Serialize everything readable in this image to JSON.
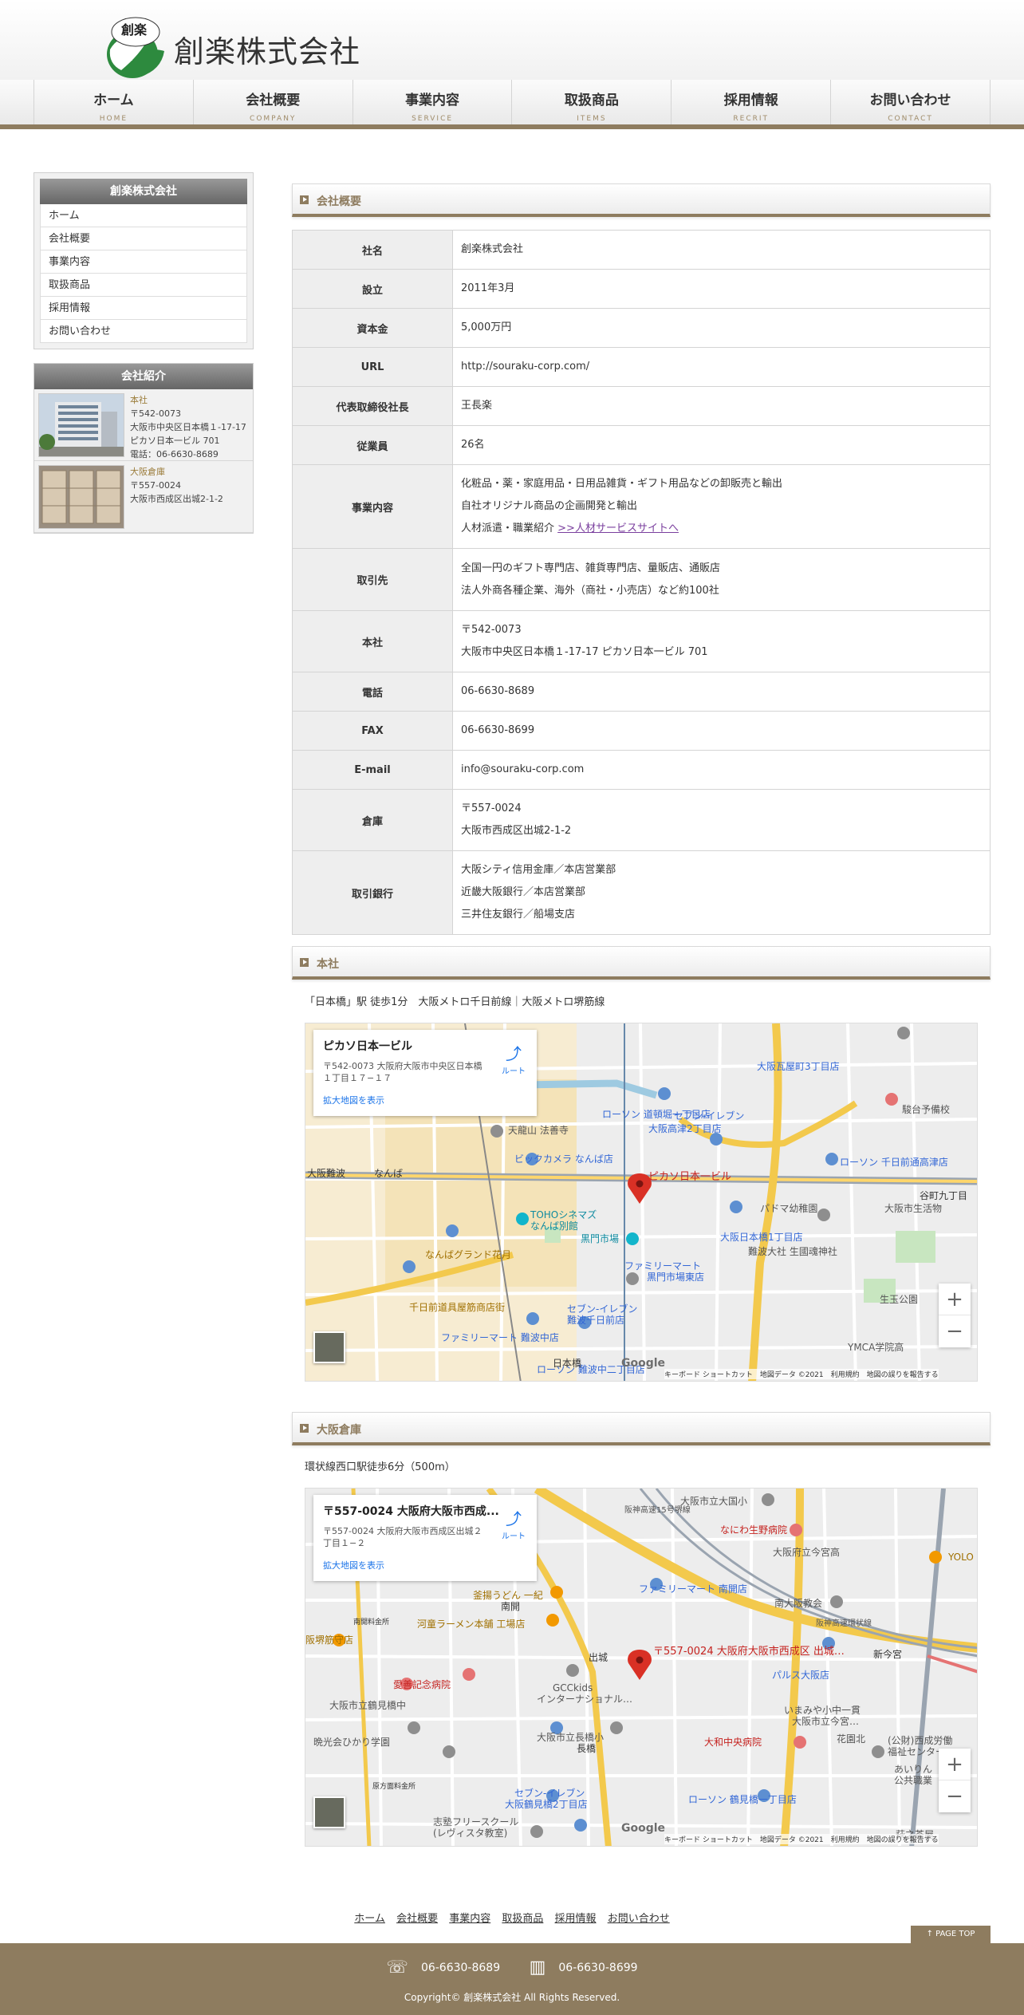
{
  "header": {
    "logo_top": "創楽",
    "logo_mark": "SR",
    "company_name": "創楽株式会社"
  },
  "nav": [
    {
      "jp": "ホーム",
      "en": "HOME"
    },
    {
      "jp": "会社概要",
      "en": "COMPANY"
    },
    {
      "jp": "事業内容",
      "en": "SERVICE"
    },
    {
      "jp": "取扱商品",
      "en": "ITEMS"
    },
    {
      "jp": "採用情報",
      "en": "RECRIT"
    },
    {
      "jp": "お問い合わせ",
      "en": "CONTACT"
    }
  ],
  "sidebar": {
    "title": "創楽株式会社",
    "items": [
      "ホーム",
      "会社概要",
      "事業内容",
      "取扱商品",
      "採用情報",
      "お問い合わせ"
    ]
  },
  "intro": {
    "title": "会社紹介",
    "items": [
      {
        "name": "本社",
        "lines": [
          "〒542-0073",
          "大阪市中央区日本橋１-17-17",
          "ピカソ日本一ビル 701",
          "電話：06-6630-8689"
        ]
      },
      {
        "name": "大阪倉庫",
        "lines": [
          "〒557-0024",
          "大阪市西成区出城2-1-2"
        ]
      }
    ]
  },
  "sections": {
    "profile": "会社概要",
    "honsha": "本社",
    "souko": "大阪倉庫"
  },
  "profile": {
    "name_label": "社名",
    "name": "創楽株式会社",
    "est_label": "設立",
    "est": "2011年3月",
    "capital_label": "資本金",
    "capital": "5,000万円",
    "url_label": "URL",
    "url": "http://souraku-corp.com/",
    "ceo_label": "代表取締役社長",
    "ceo": "王長楽",
    "staff_label": "従業員",
    "staff": "26名",
    "biz_label": "事業内容",
    "biz_1": "化粧品・薬・家庭用品・日用品雑貨・ギフト用品などの卸販売と輸出",
    "biz_2": "自社オリジナル商品の企画開発と輸出",
    "biz_3": "人材派遣・職業紹介",
    "biz_link": ">>人材サービスサイトへ",
    "clients_label": "取引先",
    "clients_1": "全国一円のギフト専門店、雑貨専門店、量販店、通販店",
    "clients_2": "法人外商各種企業、海外（商社・小売店）など約100社",
    "hq_label": "本社",
    "hq_1": "〒542-0073",
    "hq_2": "大阪市中央区日本橋１-17-17 ピカソ日本一ビル 701",
    "tel_label": "電話",
    "tel": "06-6630-8689",
    "fax_label": "FAX",
    "fax": "06-6630-8699",
    "email_label": "E-mail",
    "email": "info@souraku-corp.com",
    "wh_label": "倉庫",
    "wh_1": "〒557-0024",
    "wh_2": "大阪市西成区出城2-1-2",
    "bank_label": "取引銀行",
    "bank_1": "大阪シティ信用金庫／本店営業部",
    "bank_2": "近畿大阪銀行／本店営業部",
    "bank_3": "三井住友銀行／船場支店"
  },
  "honsha_access": "「日本橋」駅 徒歩1分　大阪メトロ千日前線｜大阪メトロ堺筋線",
  "souko_access": "環状線西口駅徒歩6分（500m）",
  "map1": {
    "title": "ピカソ日本一ビル",
    "addr": "〒542-0073 大阪府大阪市中央区日本橋１丁目１７−１７",
    "big": "拡大地図を表示",
    "route": "ルート",
    "pin_label": "ピカソ日本一ビル",
    "labels": [
      "大阪瓦屋町3丁目店",
      "ローソン 道頓堀一丁目店",
      "セブン-イレブン",
      "大阪高津2丁目店",
      "天龍山 法善寺",
      "ビックカメラ なんば店",
      "TOHOシネマズ",
      "なんば別館",
      "黒門市場",
      "なんばグランド花月",
      "ファミリーマート",
      "黒門市場東店",
      "千日前道具屋筋商店街",
      "セブン-イレブン",
      "難波千日前店",
      "ファミリーマート 難波中店",
      "ローソン 難波中二丁目店",
      "ローソン 千日前通高津店",
      "大阪市生活物",
      "パドマ幼稚園",
      "大阪日本橋1丁目店",
      "生玉公園",
      "YMCA学院高",
      "駿台予備校",
      "難波大社 生國魂神社",
      "大阪難波",
      "なんば",
      "日本橋",
      "谷町九丁目"
    ],
    "footer": "キーボード ショートカット　地図データ ©2021　利用規約　地図の誤りを報告する",
    "google": "Google",
    "zoom_in": "+",
    "zoom_out": "−"
  },
  "map2": {
    "title": "〒557-0024 大阪府大阪市西成...",
    "addr": "〒557-0024 大阪府大阪市西成区出城２丁目１−２",
    "big": "拡大地図を表示",
    "route": "ルート",
    "pin_label": "〒557-0024 大阪府大阪市西成区 出城…",
    "labels": [
      "大阪市立大国小",
      "なにわ生野病院",
      "大阪府立今宮高",
      "ファミリーマート 南開店",
      "南大阪教会",
      "釜揚うどん 一紀",
      "河童ラーメン本舗 工場店",
      "愛善記念病院",
      "GCCkids",
      "インターナショナル…",
      "パルス大阪店",
      "いまみや小中一貫",
      "大阪市立今宮…",
      "大和中央病院",
      "大阪市立鶴見橋中",
      "大阪市立長橋小",
      "晩光会ひかり学園",
      "セブン-イレブン",
      "大阪鶴見橋2丁目店",
      "ローソン 鶴見橋一丁目店",
      "志塾フリースクール",
      "(レヴィスタ教室)",
      "新今宮",
      "出城",
      "長橋",
      "南開",
      "阪神高速15号堺線",
      "阪神高速環状線",
      "(公財)西成労働",
      "福祉センター",
      "あいりん",
      "公共職業",
      "萩之茶屋",
      "花園北",
      "YOLO",
      "南開料金所",
      "阪堺筋守店",
      "原方面料金所"
    ],
    "footer": "キーボード ショートカット　地図データ ©2021　利用規約　地図の誤りを報告する",
    "google": "Google",
    "zoom_in": "+",
    "zoom_out": "−"
  },
  "footer": {
    "links": [
      "ホーム",
      "会社概要",
      "事業内容",
      "取扱商品",
      "採用情報",
      "お問い合わせ"
    ],
    "page_top": "↑ PAGE TOP",
    "tel": "06-6630-8689",
    "fax": "06-6630-8699",
    "copyright": "Copyright© 創楽株式会社 All Rights Reserved."
  },
  "colors": {
    "accent": "#8e7c5f",
    "link_purple": "#7a3f9e",
    "map_blue": "#1a73e8",
    "pin_red": "#d93025"
  }
}
